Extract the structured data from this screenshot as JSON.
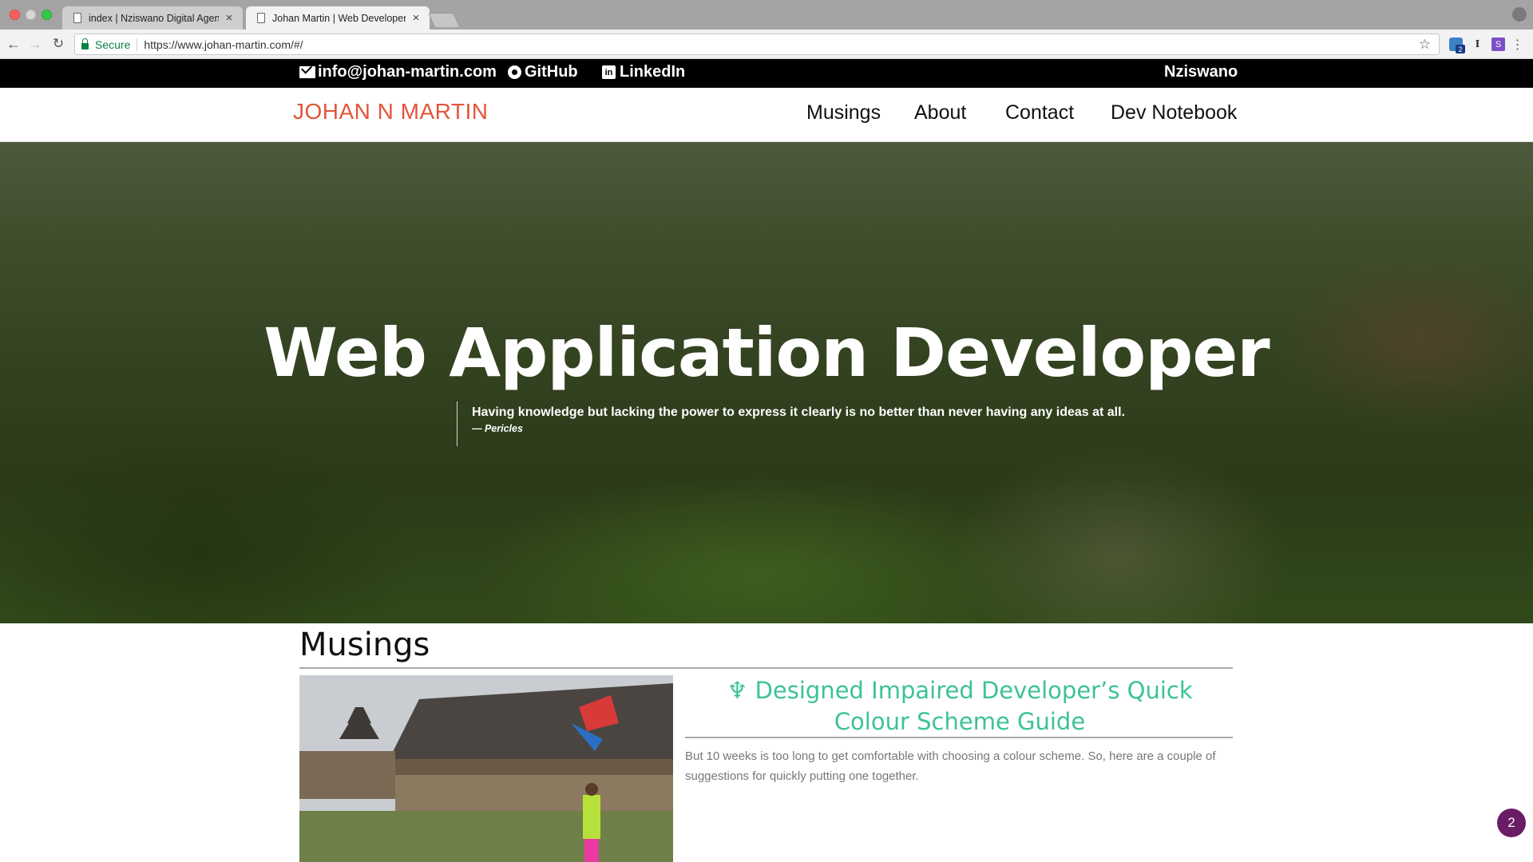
{
  "browser": {
    "tabs": [
      {
        "title": "index | Nziswano Digital Agenc",
        "close": "×"
      },
      {
        "title": "Johan Martin | Web Developer",
        "close": "×"
      }
    ],
    "secure_label": "Secure",
    "url": "https://www.johan-martin.com/#/",
    "extension_badge": "2",
    "extension_i": "I",
    "extension_s": "S",
    "menu": "⋮"
  },
  "topbar": {
    "email": "info@johan-martin.com",
    "github": "GitHub",
    "linkedin": "LinkedIn",
    "brand": "Nziswano"
  },
  "nav": {
    "logo": "JOHAN N MARTIN",
    "links": [
      "Musings",
      "About",
      "Contact",
      "Dev Notebook"
    ]
  },
  "hero": {
    "title": "Web Application Developer",
    "quote": "Having knowledge but lacking the power to express it clearly is no better than never having any ideas at all.",
    "author": "— Pericles"
  },
  "musings": {
    "heading": "Musings",
    "post": {
      "icon": "♆",
      "title": "Designed Impaired Developer’s Quick Colour Scheme Guide",
      "excerpt": "But 10 weeks is too long to get comfortable with choosing a colour scheme. So, here are a couple of suggestions for quickly putting one together."
    }
  },
  "chat": {
    "count": "2"
  },
  "colors": {
    "logo": "#e2553a",
    "post_title": "#3cc29a",
    "chat": "#6a1c66"
  }
}
